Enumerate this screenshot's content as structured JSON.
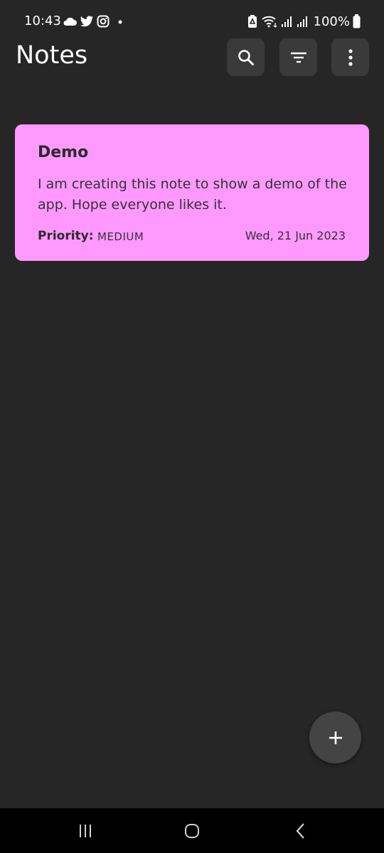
{
  "status_bar": {
    "time": "10:43",
    "battery": "100%",
    "left_icons": [
      "cloud-icon",
      "twitter-icon",
      "instagram-icon",
      "dot-icon"
    ],
    "right_icons": [
      "battery-saver-icon",
      "wifi-icon",
      "signal-icon",
      "signal-icon",
      "battery-icon"
    ]
  },
  "header": {
    "title": "Notes",
    "actions": [
      "search-icon",
      "filter-icon",
      "more-vertical-icon"
    ]
  },
  "notes": [
    {
      "title": "Demo",
      "body": "I am creating this note to show a demo of the app. Hope everyone likes it.",
      "priority_label": "Priority:",
      "priority": "MEDIUM",
      "date": "Wed, 21 Jun 2023",
      "color": "#ff99ff"
    }
  ],
  "fab": {
    "icon": "plus-icon"
  },
  "nav": {
    "buttons": [
      "recents-icon",
      "home-icon",
      "back-icon"
    ]
  },
  "colors": {
    "background": "#262626",
    "toolbar_button": "#3a3a3a",
    "fab": "#444444",
    "note_card": "#ff99ff"
  }
}
